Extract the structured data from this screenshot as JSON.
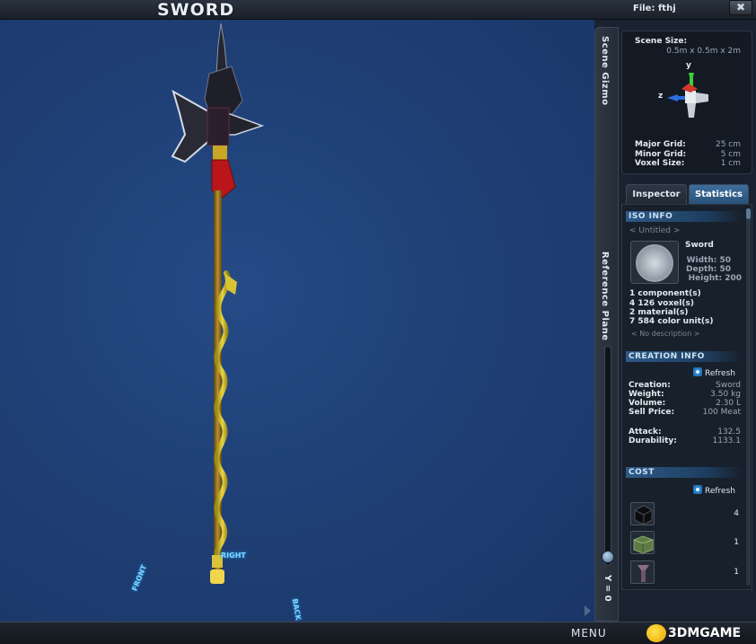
{
  "window": {
    "title": "SWORD",
    "file_label": "File: fthj",
    "close_glyph": "✖"
  },
  "viewport": {
    "direction_labels": {
      "front": "FRONT",
      "right": "RIGHT",
      "back": "BACK"
    }
  },
  "side_tabs": {
    "scene_gizmo": "Scene Gizmo",
    "reference_plane": "Reference Plane",
    "y_value": "Y = 0"
  },
  "gizmo": {
    "scene_size_label": "Scene Size:",
    "scene_size_value": "0.5m x 0.5m x 2m",
    "axis_y": "y",
    "axis_z": "z",
    "major_grid_label": "Major Grid:",
    "major_grid_value": "25 cm",
    "minor_grid_label": "Minor Grid:",
    "minor_grid_value": "5 cm",
    "voxel_size_label": "Voxel Size:",
    "voxel_size_value": "1 cm"
  },
  "tabs": {
    "inspector": "Inspector",
    "statistics": "Statistics",
    "active": "statistics"
  },
  "iso_info": {
    "header": "ISO INFO",
    "untitled": "< Untitled >",
    "name": "Sword",
    "width": "Width: 50",
    "depth": "Depth: 50",
    "height": "Height: 200",
    "components": "1 component(s)",
    "voxels": "4 126 voxel(s)",
    "materials": "2 material(s)",
    "color_units": "7 584 color unit(s)",
    "description": "< No description >"
  },
  "creation_info": {
    "header": "CREATION INFO",
    "refresh": "Refresh",
    "rows": [
      {
        "label": "Creation:",
        "value": "Sword"
      },
      {
        "label": "Weight:",
        "value": "3.50 kg"
      },
      {
        "label": "Volume:",
        "value": "2.30 L"
      },
      {
        "label": "Sell Price:",
        "value": "100 Meat"
      }
    ],
    "attack_label": "Attack:",
    "attack_value": "132.5",
    "durability_label": "Durability:",
    "durability_value": "1133.1"
  },
  "cost": {
    "header": "COST",
    "refresh": "Refresh",
    "items": [
      {
        "icon": "black-voxel-cube-icon",
        "qty": "4"
      },
      {
        "icon": "green-voxel-block-icon",
        "qty": "1"
      },
      {
        "icon": "sword-hilt-component-icon",
        "qty": "1"
      }
    ]
  },
  "bottom": {
    "menu": "MENU",
    "watermark": "3DMGAME"
  },
  "colors": {
    "viewport_bg": "#1d3a6e",
    "panel_bg": "#1a2230",
    "accent_blue": "#2d5a88",
    "label_glow": "#7fd6ff"
  }
}
